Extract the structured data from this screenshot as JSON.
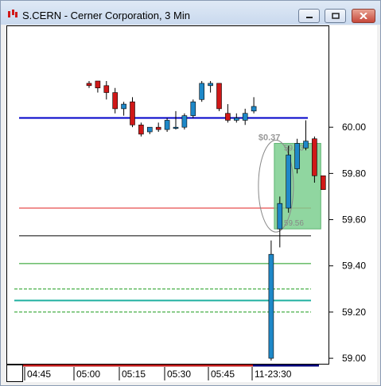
{
  "window": {
    "title": "S.CERN - Cerner Corporation, 3 Min",
    "controls": [
      "minimize",
      "maximize",
      "close"
    ]
  },
  "chart_data": {
    "type": "candlestick",
    "symbol": "S.CERN",
    "interval": "3 Min",
    "ylim": [
      58.99,
      60.2
    ],
    "price_ticks": [
      "60.00",
      "59.80",
      "59.60",
      "59.40",
      "59.20",
      "59.00"
    ],
    "time_ticks": [
      "04:45",
      "05:00",
      "05:15",
      "05:30",
      "05:45",
      "11-23:30"
    ],
    "candles": [
      {
        "o": 60.19,
        "h": 60.2,
        "l": 60.17,
        "c": 60.18
      },
      {
        "o": 60.2,
        "h": 60.2,
        "l": 60.15,
        "c": 60.17
      },
      {
        "o": 60.18,
        "h": 60.2,
        "l": 60.12,
        "c": 60.15
      },
      {
        "o": 60.15,
        "h": 60.17,
        "l": 60.06,
        "c": 60.08
      },
      {
        "o": 60.08,
        "h": 60.11,
        "l": 60.05,
        "c": 60.1
      },
      {
        "o": 60.11,
        "h": 60.13,
        "l": 60.0,
        "c": 60.01
      },
      {
        "o": 60.01,
        "h": 60.02,
        "l": 59.96,
        "c": 59.97
      },
      {
        "o": 59.98,
        "h": 60.0,
        "l": 59.97,
        "c": 60.0
      },
      {
        "o": 60.0,
        "h": 60.02,
        "l": 59.98,
        "c": 59.99
      },
      {
        "o": 59.99,
        "h": 60.04,
        "l": 59.98,
        "c": 60.03
      },
      {
        "o": 60.0,
        "h": 60.07,
        "l": 59.99,
        "c": 60.0
      },
      {
        "o": 60.0,
        "h": 60.06,
        "l": 59.99,
        "c": 60.05
      },
      {
        "o": 60.05,
        "h": 60.12,
        "l": 60.04,
        "c": 60.11
      },
      {
        "o": 60.12,
        "h": 60.2,
        "l": 60.11,
        "c": 60.19
      },
      {
        "o": 60.18,
        "h": 60.2,
        "l": 60.15,
        "c": 60.19
      },
      {
        "o": 60.19,
        "h": 60.19,
        "l": 60.07,
        "c": 60.08
      },
      {
        "o": 60.06,
        "h": 60.1,
        "l": 60.02,
        "c": 60.03
      },
      {
        "o": 60.03,
        "h": 60.06,
        "l": 60.02,
        "c": 60.04
      },
      {
        "o": 60.03,
        "h": 60.08,
        "l": 60.01,
        "c": 60.06
      },
      {
        "o": 60.07,
        "h": 60.13,
        "l": 60.06,
        "c": 60.09
      },
      {
        "o": null
      },
      {
        "o": 59.0,
        "h": 59.51,
        "l": 58.99,
        "c": 59.45
      },
      {
        "o": 59.56,
        "h": 59.7,
        "l": 59.48,
        "c": 59.67
      },
      {
        "o": 59.65,
        "h": 59.92,
        "l": 59.63,
        "c": 59.88
      },
      {
        "o": 59.82,
        "h": 59.95,
        "l": 59.8,
        "c": 59.93
      },
      {
        "o": 59.91,
        "h": 60.03,
        "l": 59.9,
        "c": 59.94
      },
      {
        "o": 59.95,
        "h": 59.96,
        "l": 59.76,
        "c": 59.79
      },
      {
        "o": 59.79,
        "h": 59.79,
        "l": 59.73,
        "c": 59.73
      }
    ],
    "levels": [
      {
        "name": "upper-blue",
        "value": 60.04,
        "color": "#0000c8",
        "style": "solid"
      },
      {
        "name": "red",
        "value": 59.65,
        "color": "#e02020",
        "style": "solid"
      },
      {
        "name": "black",
        "value": 59.53,
        "color": "#000000",
        "style": "solid"
      },
      {
        "name": "green-solid-upper",
        "value": 59.41,
        "color": "#1a9a1a",
        "style": "solid"
      },
      {
        "name": "green-dashed-1",
        "value": 59.3,
        "color": "#1a9a1a",
        "style": "dashed"
      },
      {
        "name": "teal",
        "value": 59.25,
        "color": "#20b0a0",
        "style": "solid"
      },
      {
        "name": "green-dashed-2",
        "value": 59.2,
        "color": "#1a9a1a",
        "style": "dashed"
      }
    ],
    "annotation": {
      "price_move": "$0.37",
      "upper_label": "59.93",
      "lower_label": "59.56",
      "box_top": 59.93,
      "box_bottom": 59.56
    },
    "colors": {
      "up": "#1e88c8",
      "down": "#d01818",
      "wick": "#000000"
    }
  }
}
